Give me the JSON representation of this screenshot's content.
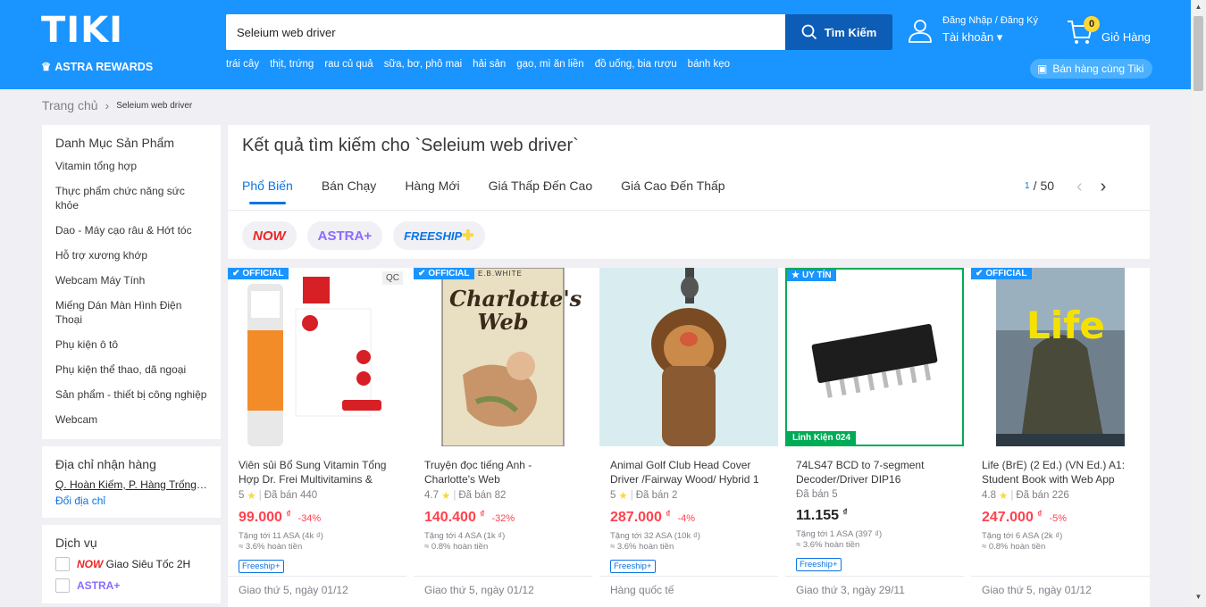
{
  "header": {
    "logo": "TIKI",
    "astra": "ASTRA REWARDS",
    "search_value": "Seleium web driver",
    "search_button": "Tìm Kiếm",
    "keywords": [
      "trái cây",
      "thịt, trứng",
      "rau củ quả",
      "sữa, bơ, phô mai",
      "hải sản",
      "gạo, mì ăn liền",
      "đồ uống, bia rượu",
      "bánh kẹo"
    ],
    "login": "Đăng Nhập / Đăng Ký",
    "account": "Tài khoản",
    "cart_count": "0",
    "cart_label": "Giỏ Hàng",
    "sell_label": "Bán hàng cùng Tiki",
    "accent": "#1a94ff"
  },
  "breadcrumb": {
    "home": "Trang chủ",
    "current": "Seleium web driver"
  },
  "sidebar": {
    "categories_title": "Danh Mục Sản Phẩm",
    "categories": [
      "Vitamin tổng hợp",
      "Thực phẩm chức năng sức khỏe",
      "Dao - Máy cạo râu & Hớt tóc",
      "Hỗ trợ xương khớp",
      "Webcam Máy Tính",
      "Miếng Dán Màn Hình Điện Thoại",
      "Phụ kiện ô tô",
      "Phụ kiện thể thao, dã ngoại",
      "Sản phẩm - thiết bị công nghiệp",
      "Webcam"
    ],
    "address_title": "Địa chỉ nhận hàng",
    "address": "Q. Hoàn Kiếm, P. Hàng Trống, Hà Nội",
    "change_address": "Đổi địa chỉ",
    "services_title": "Dịch vụ",
    "service_now": "NOW",
    "service_now_text": "Giao Siêu Tốc 2H",
    "service_astra": "ASTRA+"
  },
  "main": {
    "title": "Kết quả tìm kiếm cho `Seleium web driver`",
    "tabs": [
      "Phổ Biến",
      "Bán Chạy",
      "Hàng Mới",
      "Giá Thấp Đến Cao",
      "Giá Cao Đến Thấp"
    ],
    "page_current": "1",
    "page_sep": "/",
    "page_total": "50",
    "filters": {
      "now": "NOW",
      "astra": "ASTRA+",
      "freeship": "FREESHIP"
    }
  },
  "products": [
    {
      "badge": "OFFICIAL",
      "qc": "QC",
      "name": "Viên sủi Bổ Sung Vitamin Tổng Hợp Dr. Frei Multivitamins & Minerals",
      "rating": "5",
      "sold": "Đã bán 440",
      "price": "99.000",
      "currency": "₫",
      "discount": "-34%",
      "asa": "Tặng tới 11 ASA (4k ₫)",
      "cashback": "≈ 3.6% hoàn tiền",
      "freeship": "Freeship+",
      "delivery": "Giao thứ 5, ngày 01/12"
    },
    {
      "badge": "OFFICIAL",
      "name": "Truyện đọc tiếng Anh - Charlotte's Web",
      "rating": "4.7",
      "sold": "Đã bán 82",
      "price": "140.400",
      "currency": "₫",
      "discount": "-32%",
      "asa": "Tặng tới 4 ASA (1k ₫)",
      "cashback": "≈ 0.8% hoàn tiền",
      "delivery": "Giao thứ 5, ngày 01/12",
      "book_author": "E.B.WHITE",
      "book_title": "Charlotte's Web"
    },
    {
      "name": "Animal Golf Club Head Cover Driver /Fairway Wood/ Hybrid 1 cái",
      "rating": "5",
      "sold": "Đã bán 2",
      "price": "287.000",
      "currency": "₫",
      "discount": "-4%",
      "asa": "Tặng tới 32 ASA (10k ₫)",
      "cashback": "≈ 3.6% hoàn tiền",
      "freeship": "Freeship+",
      "delivery": "Hàng quốc tế"
    },
    {
      "badge": "UY TÍN",
      "seller": "Linh Kiện 024",
      "name": "74LS47 BCD to 7-segment Decoder/Driver DIP16",
      "sold": "Đã bán 5",
      "price": "11.155",
      "currency": "₫",
      "asa": "Tặng tới 1 ASA (397 ₫)",
      "cashback": "≈ 3.6% hoàn tiền",
      "freeship": "Freeship+",
      "delivery": "Giao thứ 3, ngày 29/11"
    },
    {
      "badge": "OFFICIAL",
      "name": "Life (BrE) (2 Ed.) (VN Ed.) A1: Student Book with Web App Code",
      "rating": "4.8",
      "sold": "Đã bán 226",
      "price": "247.000",
      "currency": "₫",
      "discount": "-5%",
      "asa": "Tặng tới 6 ASA (2k ₫)",
      "cashback": "≈ 0.8% hoàn tiền",
      "delivery": "Giao thứ 5, ngày 01/12",
      "book_title": "Life"
    }
  ]
}
